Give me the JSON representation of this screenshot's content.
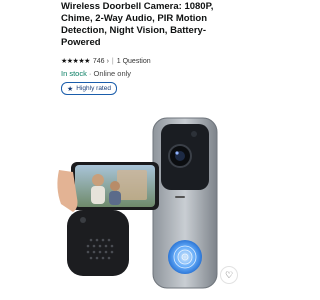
{
  "product": {
    "title": "Wireless Doorbell Camera: 1080P, Chime, 2-Way Audio, PIR Motion Detection, Night Vision, Battery-Powered",
    "rating_stars": "★★★★★",
    "rating_count": "746",
    "questions": "1 Question",
    "stock_status": "In stock",
    "availability": " · Online only",
    "badge_label": "Highly rated"
  },
  "icons": {
    "star": "star-icon",
    "chevron": "chevron-right-icon",
    "favorite": "heart-icon"
  },
  "colors": {
    "in_stock": "#067d62",
    "badge_border": "#1a5dab",
    "title": "#0f1111"
  }
}
